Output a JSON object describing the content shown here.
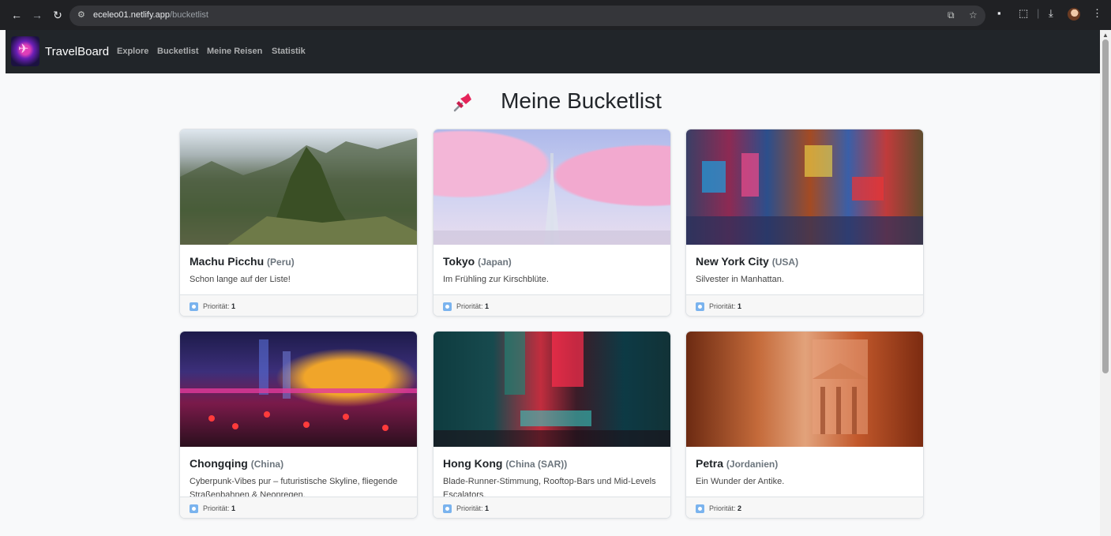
{
  "browser": {
    "url_host": "eceleo01.netlify.app",
    "url_path": "/bucketlist"
  },
  "navbar": {
    "brand": "TravelBoard",
    "links": [
      "Explore",
      "Bucketlist",
      "Meine Reisen",
      "Statistik"
    ]
  },
  "page": {
    "title": "Meine Bucketlist"
  },
  "priority_label": "Priorität:",
  "cards": [
    {
      "name": "Machu Picchu",
      "country": "(Peru)",
      "text": "Schon lange auf der Liste!",
      "priority": "1",
      "image": "machu-picchu-photo"
    },
    {
      "name": "Tokyo",
      "country": "(Japan)",
      "text": "Im Frühling zur Kirschblüte.",
      "priority": "1",
      "image": "tokyo-cherry-blossom-photo"
    },
    {
      "name": "New York City",
      "country": "(USA)",
      "text": "Silvester in Manhattan.",
      "priority": "1",
      "image": "times-square-photo"
    },
    {
      "name": "Chongqing",
      "country": "(China)",
      "text": "Cyberpunk-Vibes pur – futuristische Skyline, fliegende Straßenbahnen & Neonregen.",
      "priority": "1",
      "image": "chongqing-night-photo"
    },
    {
      "name": "Hong Kong",
      "country": "(China (SAR))",
      "text": "Blade-Runner-Stimmung, Rooftop-Bars und Mid-Levels Escalators.",
      "priority": "1",
      "image": "hong-kong-neon-photo"
    },
    {
      "name": "Petra",
      "country": "(Jordanien)",
      "text": "Ein Wunder der Antike.",
      "priority": "2",
      "image": "petra-treasury-photo"
    }
  ],
  "icons": {
    "back": "arrow-left-icon",
    "forward": "arrow-right-icon",
    "reload": "reload-icon",
    "site_info": "tune-icon",
    "translate": "translate-icon",
    "bookmark": "star-icon",
    "pin": "pushpin-icon",
    "priority": "person-badge-icon"
  },
  "colors": {
    "navbar_bg": "#212529",
    "page_bg": "#f8f9fa",
    "priority_icon": "#7ab3ee"
  }
}
